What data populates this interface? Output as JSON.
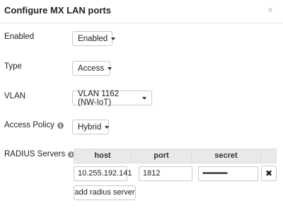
{
  "dialog": {
    "title": "Configure MX LAN ports",
    "close_glyph": "×"
  },
  "fields": {
    "enabled": {
      "label": "Enabled",
      "value": "Enabled"
    },
    "type": {
      "label": "Type",
      "value": "Access"
    },
    "vlan": {
      "label": "VLAN",
      "value": "VLAN 1162 (NW-IoT)"
    },
    "access_policy": {
      "label": "Access Policy",
      "value": "Hybrid"
    },
    "radius": {
      "label": "RADIUS Servers"
    }
  },
  "radius_table": {
    "headers": [
      "host",
      "port",
      "secret",
      ""
    ],
    "rows": [
      {
        "host": "10.255.192.141",
        "port": "1812",
        "secret": "••••••••••••••",
        "delete_glyph": "✖"
      }
    ],
    "add_label": "add radius server"
  },
  "icons": {
    "info": "info-icon",
    "close": "close-icon",
    "delete": "delete-icon",
    "caret": "caret-down-icon"
  },
  "colors": {
    "header_bg": "#e9e9e9",
    "border": "#c9c9c9"
  }
}
